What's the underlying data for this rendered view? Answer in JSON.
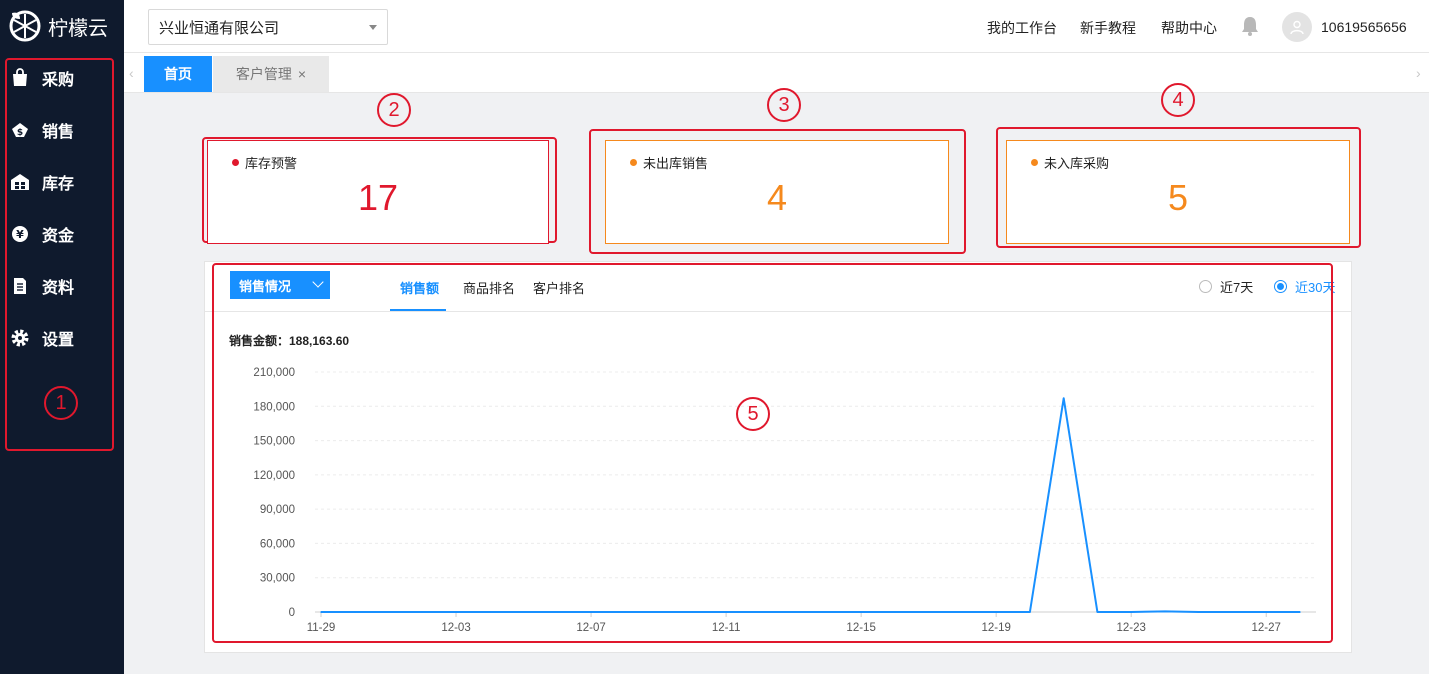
{
  "app": {
    "name": "柠檬云"
  },
  "sidebar": {
    "items": [
      {
        "label": "采购",
        "icon": "shopping-bag-icon"
      },
      {
        "label": "销售",
        "icon": "money-bag-icon"
      },
      {
        "label": "库存",
        "icon": "warehouse-icon"
      },
      {
        "label": "资金",
        "icon": "yen-coin-icon"
      },
      {
        "label": "资料",
        "icon": "document-icon"
      },
      {
        "label": "设置",
        "icon": "gear-icon"
      }
    ]
  },
  "header": {
    "company": "兴业恒通有限公司",
    "links": [
      "我的工作台",
      "新手教程",
      "帮助中心"
    ],
    "account": "10619565656"
  },
  "tabs": {
    "home": "首页",
    "customer": "客户管理",
    "close_glyph": "×"
  },
  "stats": [
    {
      "label": "库存预警",
      "value": "17",
      "color": "#e0182d"
    },
    {
      "label": "未出库销售",
      "value": "4",
      "color": "#f5891d"
    },
    {
      "label": "未入库采购",
      "value": "5",
      "color": "#f5891d"
    }
  ],
  "annotations": [
    "1",
    "2",
    "3",
    "4",
    "5"
  ],
  "panel": {
    "dropdown": "销售情况",
    "tabs": [
      "销售额",
      "商品排名",
      "客户排名"
    ],
    "ranges": [
      "近7天",
      "近30天"
    ],
    "selected_range": "近30天",
    "total_label": "销售金额：188,163.60"
  },
  "chart_data": {
    "type": "line",
    "color": "#1890ff",
    "ylim": [
      0,
      210000
    ],
    "yticks": [
      0,
      30000,
      60000,
      90000,
      120000,
      150000,
      180000,
      210000
    ],
    "ytick_labels": [
      "0",
      "30,000",
      "60,000",
      "90,000",
      "120,000",
      "150,000",
      "180,000",
      "210,000"
    ],
    "xtick_labels": [
      "11-29",
      "12-03",
      "12-07",
      "12-11",
      "12-15",
      "12-19",
      "12-23",
      "12-27"
    ],
    "x": [
      "11-29",
      "11-30",
      "12-01",
      "12-02",
      "12-03",
      "12-04",
      "12-05",
      "12-06",
      "12-07",
      "12-08",
      "12-09",
      "12-10",
      "12-11",
      "12-12",
      "12-13",
      "12-14",
      "12-15",
      "12-16",
      "12-17",
      "12-18",
      "12-19",
      "12-20",
      "12-21",
      "12-22",
      "12-23",
      "12-24",
      "12-25",
      "12-26",
      "12-27",
      "12-28"
    ],
    "values": [
      0,
      0,
      0,
      0,
      0,
      0,
      0,
      0,
      0,
      0,
      0,
      0,
      0,
      0,
      0,
      0,
      0,
      0,
      0,
      0,
      0,
      0,
      187000,
      0,
      0,
      500,
      0,
      0,
      0,
      0
    ]
  }
}
